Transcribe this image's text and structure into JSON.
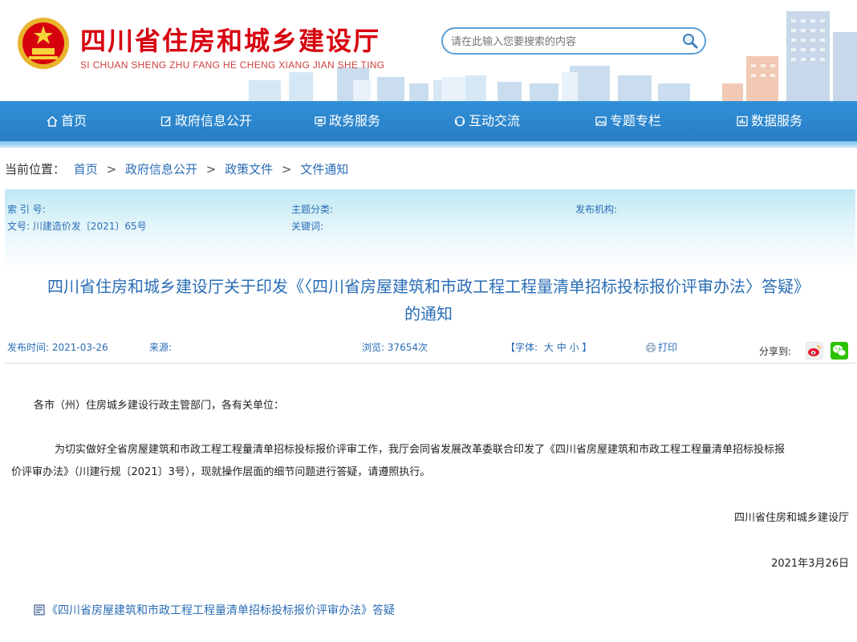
{
  "header": {
    "title": "四川省住房和城乡建设厅",
    "subtitle": "SI CHUAN SHENG ZHU FANG HE CHENG XIANG JIAN SHE TING",
    "search_placeholder": "请在此输入您要搜索的内容"
  },
  "nav": {
    "items": [
      {
        "label": "首页",
        "icon": "home-icon"
      },
      {
        "label": "政府信息公开",
        "icon": "edit-icon"
      },
      {
        "label": "政务服务",
        "icon": "monitor-icon"
      },
      {
        "label": "互动交流",
        "icon": "chat-icon"
      },
      {
        "label": "专题专栏",
        "icon": "image-icon"
      },
      {
        "label": "数据服务",
        "icon": "chart-icon"
      }
    ]
  },
  "breadcrumb": {
    "prefix": "当前位置：",
    "items": [
      "首页",
      "政府信息公开",
      "政策文件",
      "文件通知"
    ],
    "separator": ">"
  },
  "info": {
    "index_label": "索 引 号:",
    "topic_label": "主题分类:",
    "publisher_label": "发布机构:",
    "doc_no_label": "文号:",
    "doc_no_value": "川建造价发〔2021〕65号",
    "keywords_label": "关键词:"
  },
  "article": {
    "title_line1": "四川省住房和城乡建设厅关于印发《〈四川省房屋建筑和市政工程工程量清单招标投标报价评审办法〉答疑》",
    "title_line2": "的通知"
  },
  "meta": {
    "date_label": "发布时间:",
    "date_value": "2021-03-26",
    "source_label": "来源:",
    "views_label": "浏览:",
    "views_value": "37654次",
    "font_open": "【字体:",
    "font_large": "大",
    "font_medium": "中",
    "font_small": "小",
    "font_close": "】",
    "print_label": "打印",
    "share_label": "分享到:"
  },
  "body": {
    "greeting": "各市（州）住房城乡建设行政主管部门，各有关单位：",
    "para1_line1": "为切实做好全省房屋建筑和市政工程工程量清单招标投标报价评审工作，我厅会同省发展改革委联合印发了《四川省房屋建筑和市政工程工程量清单招标投标报",
    "para1_line2": "价评审办法》（川建行规〔2021〕3号），现就操作层面的细节问题进行答疑，请遵照执行。",
    "signature": "四川省住房和城乡建设厅",
    "sign_date": "2021年3月26日",
    "attachment": "《四川省房屋建筑和市政工程工程量清单招标投标报价评审办法》答疑"
  },
  "colors": {
    "brand_red": "#d7000f",
    "nav_blue": "#2a7fc6",
    "link_blue": "#2a6db5"
  }
}
